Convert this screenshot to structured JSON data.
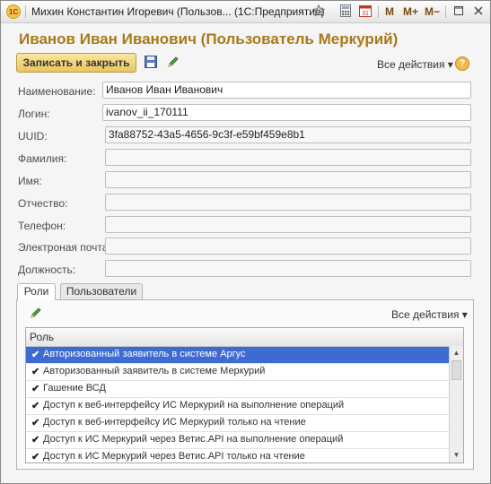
{
  "window": {
    "title": "Михин Константин Игоревич (Пользов... (1С:Предприятие)",
    "logo": "1С",
    "m_buttons": [
      "M",
      "M+",
      "M−"
    ]
  },
  "heading": "Иванов Иван Иванович (Пользователь Меркурий)",
  "toolbar": {
    "save_close_label": "Записать и закрыть",
    "all_actions_label": "Все действия ▾",
    "help_label": "?"
  },
  "fields": [
    {
      "label": "Наименование:",
      "value": "Иванов Иван Иванович"
    },
    {
      "label": "Логин:",
      "value": "ivanov_ii_170111"
    },
    {
      "label": "UUID:",
      "value": "3fa88752-43a5-4656-9c3f-e59bf459e8b1"
    },
    {
      "label": "Фамилия:",
      "value": ""
    },
    {
      "label": "Имя:",
      "value": ""
    },
    {
      "label": "Отчество:",
      "value": ""
    },
    {
      "label": "Телефон:",
      "value": ""
    },
    {
      "label": "Электроная почта:",
      "value": ""
    },
    {
      "label": "Должность:",
      "value": ""
    }
  ],
  "tabs": [
    {
      "label": "Роли",
      "active": true
    },
    {
      "label": "Пользователи",
      "active": false
    }
  ],
  "grid": {
    "all_actions_label": "Все действия ▾",
    "column": "Роль",
    "rows": [
      {
        "text": "Авторизованный заявитель в системе Аргус",
        "checked": true,
        "selected": true
      },
      {
        "text": "Авторизованный заявитель в системе Меркурий",
        "checked": true,
        "selected": false
      },
      {
        "text": "Гашение ВСД",
        "checked": true,
        "selected": false
      },
      {
        "text": "Доступ к веб-интерфейсу ИС Меркурий на выполнение операций",
        "checked": true,
        "selected": false
      },
      {
        "text": "Доступ к веб-интерфейсу ИС Меркурий только на чтение",
        "checked": true,
        "selected": false
      },
      {
        "text": "Доступ к ИС Меркурий через Ветис.API на выполнение операций",
        "checked": true,
        "selected": false
      },
      {
        "text": "Доступ к ИС Меркурий через Ветис.API только на чтение",
        "checked": true,
        "selected": false
      }
    ]
  },
  "icons": {
    "save": "floppy-disk-icon",
    "edit": "pencil-icon",
    "help": "question-icon",
    "check": "✔"
  },
  "colors": {
    "heading": "#a8791a",
    "primary_button": "#e8c55e",
    "selection": "#3d6bd1"
  }
}
